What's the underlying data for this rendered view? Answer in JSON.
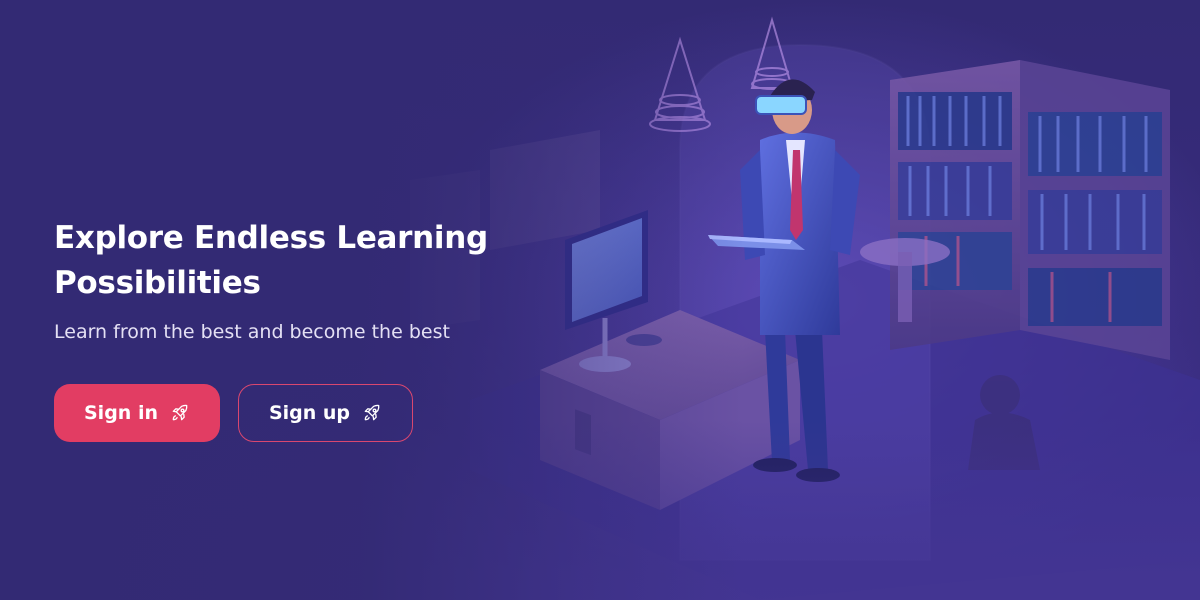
{
  "hero": {
    "title_line1": "Explore Endless Learning",
    "title_line2": "Possibilities",
    "subtitle": "Learn from the best and become the best"
  },
  "buttons": {
    "sign_in_label": "Sign in",
    "sign_up_label": "Sign up",
    "icon": "rocket-icon"
  },
  "colors": {
    "background": "#372b7c",
    "accent": "#e23d63",
    "accent_border": "#d9476f",
    "text": "#ffffff"
  },
  "illustration": {
    "description_icon": "vr-learning-illustration"
  }
}
